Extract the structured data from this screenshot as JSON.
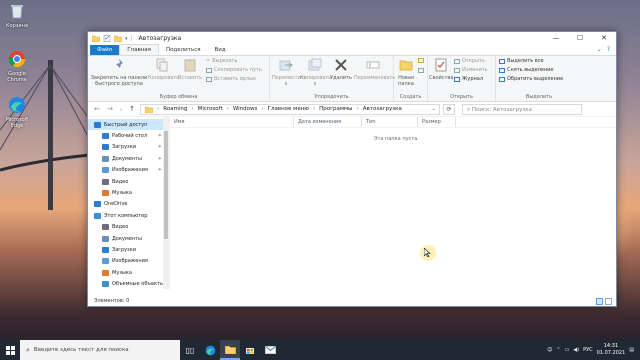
{
  "desktop": {
    "icons": [
      {
        "label": "Корзина",
        "icon": "recycle-bin-icon"
      },
      {
        "label": "Google Chrome",
        "icon": "chrome-icon"
      },
      {
        "label": "Microsoft Edge",
        "icon": "edge-icon"
      }
    ]
  },
  "window": {
    "title": "Автозагрузка",
    "controls": {
      "minimize": "—",
      "maximize": "☐",
      "close": "✕"
    },
    "tabs": [
      {
        "label": "Файл"
      },
      {
        "label": "Главная"
      },
      {
        "label": "Поделиться"
      },
      {
        "label": "Вид"
      }
    ],
    "help": {
      "collapse": "⌄",
      "help": "?"
    }
  },
  "ribbon": {
    "clipboard": {
      "pin": "Закрепить на панели быстрого доступа",
      "copy": "Копировать",
      "paste": "Вставить",
      "cut": "Вырезать",
      "copy_path": "Скопировать путь",
      "paste_shortcut": "Вставить ярлык",
      "label": "Буфер обмена"
    },
    "organize": {
      "move": "Переместить в",
      "copy_to": "Копировать в",
      "delete": "Удалить",
      "rename": "Переименовать",
      "label": "Упорядочить"
    },
    "new": {
      "new_folder": "Новая папка",
      "label": "Создать"
    },
    "open": {
      "properties": "Свойства",
      "open": "Открыть",
      "edit": "Изменить",
      "history": "Журнал",
      "label": "Открыть"
    },
    "select": {
      "select_all": "Выделить все",
      "select_none": "Снять выделение",
      "invert": "Обратить выделение",
      "label": "Выделить"
    }
  },
  "address": {
    "crumbs": [
      "Roaming",
      "Microsoft",
      "Windows",
      "Главное меню",
      "Программы",
      "Автозагрузка"
    ],
    "search_placeholder": "Поиск: Автозагрузка"
  },
  "nav": {
    "items": [
      {
        "label": "Быстрый доступ",
        "icon": "star-icon",
        "color": "#2b7cd3",
        "pinned": false,
        "indent": false,
        "selected": true
      },
      {
        "label": "Рабочий стол",
        "icon": "desktop-folder-icon",
        "color": "#2b7cd3",
        "pinned": true,
        "indent": true,
        "selected": false
      },
      {
        "label": "Загрузки",
        "icon": "download-icon",
        "color": "#2b7cd3",
        "pinned": true,
        "indent": true,
        "selected": false
      },
      {
        "label": "Документы",
        "icon": "documents-icon",
        "color": "#6d8fb3",
        "pinned": true,
        "indent": true,
        "selected": false
      },
      {
        "label": "Изображения",
        "icon": "pictures-icon",
        "color": "#5a9bd5",
        "pinned": true,
        "indent": true,
        "selected": false
      },
      {
        "label": "Видео",
        "icon": "video-icon",
        "color": "#6d6d7d",
        "pinned": false,
        "indent": true,
        "selected": false
      },
      {
        "label": "Музыка",
        "icon": "music-icon",
        "color": "#e07b2b",
        "pinned": false,
        "indent": true,
        "selected": false
      },
      {
        "label": "OneDrive",
        "icon": "cloud-icon",
        "color": "#2b7cd3",
        "pinned": false,
        "indent": false,
        "selected": false
      },
      {
        "label": "Этот компьютер",
        "icon": "computer-icon",
        "color": "#3b8ed8",
        "pinned": false,
        "indent": false,
        "selected": false
      },
      {
        "label": "Видео",
        "icon": "video-icon",
        "color": "#6d6d7d",
        "pinned": false,
        "indent": true,
        "selected": false
      },
      {
        "label": "Документы",
        "icon": "documents-icon",
        "color": "#6d8fb3",
        "pinned": false,
        "indent": true,
        "selected": false
      },
      {
        "label": "Загрузки",
        "icon": "download-icon",
        "color": "#2b7cd3",
        "pinned": false,
        "indent": true,
        "selected": false
      },
      {
        "label": "Изображения",
        "icon": "pictures-icon",
        "color": "#5a9bd5",
        "pinned": false,
        "indent": true,
        "selected": false
      },
      {
        "label": "Музыка",
        "icon": "music-icon",
        "color": "#e07b2b",
        "pinned": false,
        "indent": true,
        "selected": false
      },
      {
        "label": "Объемные объекты",
        "icon": "3d-objects-icon",
        "color": "#3b8ed8",
        "pinned": false,
        "indent": true,
        "selected": false
      }
    ]
  },
  "files": {
    "columns": [
      "Имя",
      "Дата изменения",
      "Тип",
      "Размер"
    ],
    "empty_text": "Эта папка пуста."
  },
  "status": {
    "text": "Элементов: 0"
  },
  "taskbar": {
    "search_placeholder": "Введите здесь текст для поиска",
    "lang": "РУС",
    "time": "14:31",
    "date": "01.07.2021"
  }
}
